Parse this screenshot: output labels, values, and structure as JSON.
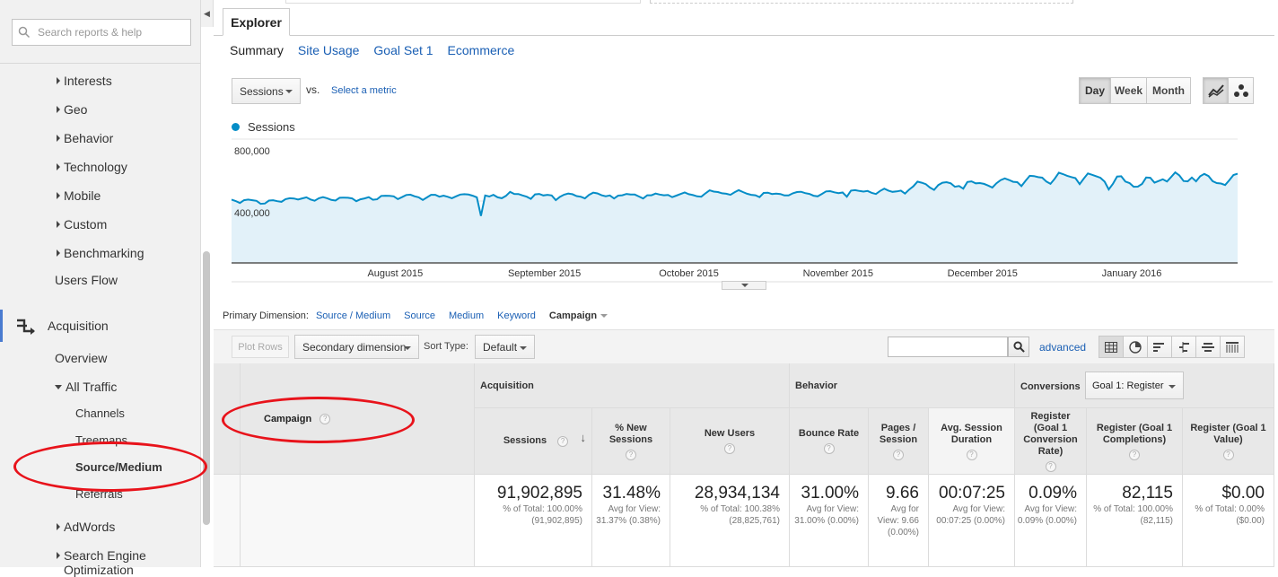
{
  "sidebar": {
    "search_placeholder": "Search reports & help",
    "items": [
      {
        "label": "Interests"
      },
      {
        "label": "Geo"
      },
      {
        "label": "Behavior"
      },
      {
        "label": "Technology"
      },
      {
        "label": "Mobile"
      },
      {
        "label": "Custom"
      },
      {
        "label": "Benchmarking"
      },
      {
        "label": "Users Flow"
      },
      {
        "label": "Acquisition"
      },
      {
        "label": "Overview"
      },
      {
        "label": "All Traffic"
      },
      {
        "label": "Channels"
      },
      {
        "label": "Treemaps"
      },
      {
        "label": "Source/Medium"
      },
      {
        "label": "Referrals"
      },
      {
        "label": "AdWords"
      },
      {
        "label": "Search Engine Optimization"
      }
    ]
  },
  "explorer": {
    "tab": "Explorer",
    "subtabs": [
      "Summary",
      "Site Usage",
      "Goal Set 1",
      "Ecommerce"
    ],
    "metric": "Sessions",
    "vs": "vs.",
    "select_metric": "Select a metric",
    "ranges": [
      "Day",
      "Week",
      "Month"
    ]
  },
  "chart_data": {
    "type": "area",
    "series": [
      {
        "name": "Sessions",
        "color": "#058dc7"
      }
    ],
    "y_tick_labels": [
      "800,000",
      "400,000"
    ],
    "x_tick_labels": [
      "August 2015",
      "September 2015",
      "October 2015",
      "November 2015",
      "December 2015",
      "January 2016"
    ],
    "ylim": [
      0,
      800000
    ],
    "x_start": "2015-07-13",
    "x_end": "2016-02-07",
    "values": [
      409000,
      400000,
      387000,
      405000,
      409000,
      405000,
      401000,
      382000,
      384000,
      403000,
      405000,
      399000,
      395000,
      412000,
      418000,
      416000,
      410000,
      417000,
      424000,
      410000,
      402000,
      418000,
      425000,
      418000,
      407000,
      403000,
      421000,
      422000,
      421000,
      417000,
      399000,
      411000,
      417000,
      425000,
      408000,
      411000,
      433000,
      434000,
      433000,
      430000,
      412000,
      425000,
      439000,
      441000,
      431000,
      424000,
      407000,
      423000,
      440000,
      440000,
      428000,
      435000,
      427000,
      418000,
      430000,
      442000,
      444000,
      442000,
      434000,
      424000,
      304000,
      436000,
      429000,
      440000,
      424000,
      418000,
      433000,
      459000,
      446000,
      445000,
      436000,
      428000,
      414000,
      443000,
      446000,
      436000,
      440000,
      436000,
      406000,
      427000,
      441000,
      448000,
      444000,
      432000,
      428000,
      417000,
      440000,
      454000,
      449000,
      437000,
      431000,
      436000,
      416000,
      435000,
      437000,
      446000,
      442000,
      442000,
      429000,
      416000,
      437000,
      437000,
      448000,
      442000,
      437000,
      439000,
      425000,
      435000,
      445000,
      455000,
      444000,
      438000,
      430000,
      428000,
      450000,
      469000,
      461000,
      458000,
      450000,
      447000,
      440000,
      456000,
      470000,
      458000,
      447000,
      440000,
      437000,
      425000,
      452000,
      454000,
      445000,
      448000,
      445000,
      436000,
      436000,
      450000,
      458000,
      460000,
      451000,
      446000,
      434000,
      430000,
      446000,
      462000,
      464000,
      456000,
      451000,
      455000,
      428000,
      467000,
      470000,
      465000,
      461000,
      465000,
      453000,
      445000,
      465000,
      480000,
      467000,
      459000,
      462000,
      467000,
      448000,
      474000,
      495000,
      525000,
      518000,
      509000,
      487000,
      472000,
      503000,
      518000,
      522000,
      514000,
      492000,
      497000,
      480000,
      523000,
      527000,
      514000,
      516000,
      511000,
      500000,
      487000,
      515000,
      535000,
      546000,
      536000,
      524000,
      522000,
      496000,
      531000,
      563000,
      561000,
      554000,
      551000,
      526000,
      511000,
      544000,
      583000,
      574000,
      563000,
      555000,
      548000,
      509000,
      545000,
      578000,
      569000,
      560000,
      550000,
      525000,
      475000,
      510000,
      558000,
      560000,
      526000,
      516000,
      492000,
      493000,
      510000,
      552000,
      550000,
      519000,
      529000,
      540000,
      526000,
      555000,
      585000,
      565000,
      529000,
      527000,
      552000,
      527000,
      560000,
      575000,
      561000,
      528000,
      516000,
      513000,
      503000,
      534000,
      568000,
      576000
    ]
  },
  "primary_dimension": {
    "label": "Primary Dimension:",
    "options": [
      "Source / Medium",
      "Source",
      "Medium",
      "Keyword"
    ],
    "current": "Campaign"
  },
  "toolbar": {
    "plot_rows": "Plot Rows",
    "secondary_dimension": "Secondary dimension",
    "sort_type_label": "Sort Type:",
    "sort_type_value": "Default",
    "advanced": "advanced"
  },
  "table": {
    "dimension_header": "Campaign",
    "groups": [
      "Acquisition",
      "Behavior",
      "Conversions"
    ],
    "goal_select": "Goal 1: Register",
    "columns": [
      {
        "label": "Sessions",
        "total": "91,902,895",
        "sub": "% of Total: 100.00% (91,902,895)"
      },
      {
        "label": "% New Sessions",
        "total": "31.48%",
        "sub": "Avg for View: 31.37% (0.38%)"
      },
      {
        "label": "New Users",
        "total": "28,934,134",
        "sub": "% of Total: 100.38% (28,825,761)"
      },
      {
        "label": "Bounce Rate",
        "total": "31.00%",
        "sub": "Avg for View: 31.00% (0.00%)"
      },
      {
        "label": "Pages / Session",
        "total": "9.66",
        "sub": "Avg for View: 9.66 (0.00%)"
      },
      {
        "label": "Avg. Session Duration",
        "total": "00:07:25",
        "sub": "Avg for View: 00:07:25 (0.00%)"
      },
      {
        "label": "Register (Goal 1 Conversion Rate)",
        "total": "0.09%",
        "sub": "Avg for View: 0.09% (0.00%)"
      },
      {
        "label": "Register (Goal 1 Completions)",
        "total": "82,115",
        "sub": "% of Total: 100.00% (82,115)"
      },
      {
        "label": "Register (Goal 1 Value)",
        "total": "$0.00",
        "sub": "% of Total: 0.00% ($0.00)"
      }
    ]
  },
  "colors": {
    "accent": "#058dc7",
    "link": "#1a5fb4",
    "annotation": "#e8131b"
  }
}
